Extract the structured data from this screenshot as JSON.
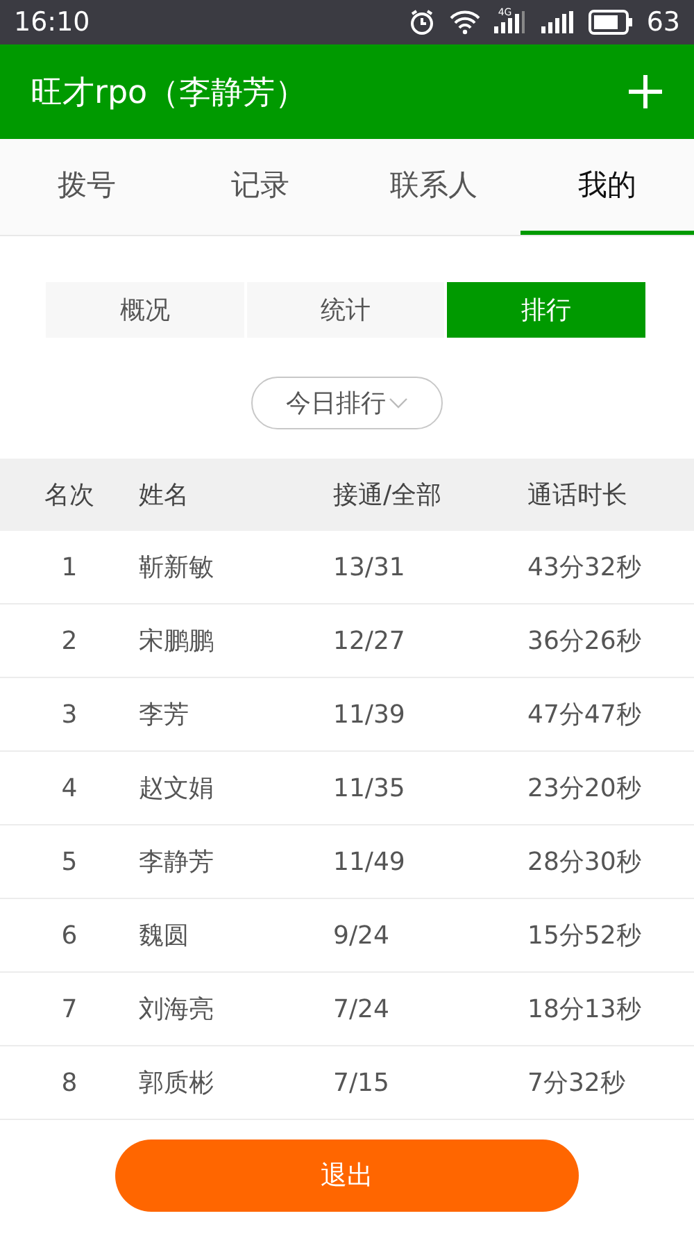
{
  "status_bar": {
    "time": "16:10",
    "network_label": "4G",
    "battery": "63"
  },
  "header": {
    "title": "旺才rpo（李静芳）"
  },
  "tabs": [
    {
      "label": "拨号",
      "selected": false
    },
    {
      "label": "记录",
      "selected": false
    },
    {
      "label": "联系人",
      "selected": false
    },
    {
      "label": "我的",
      "selected": true
    }
  ],
  "segments": [
    {
      "label": "概况",
      "selected": false
    },
    {
      "label": "统计",
      "selected": false
    },
    {
      "label": "排行",
      "selected": true
    }
  ],
  "period_dropdown": {
    "value": "今日排行"
  },
  "table": {
    "columns": [
      "名次",
      "姓名",
      "接通/全部",
      "通话时长"
    ],
    "rows": [
      [
        "1",
        "靳新敏",
        "13/31",
        "43分32秒"
      ],
      [
        "2",
        "宋鹏鹏",
        "12/27",
        "36分26秒"
      ],
      [
        "3",
        "李芳",
        "11/39",
        "47分47秒"
      ],
      [
        "4",
        "赵文娟",
        "11/35",
        "23分20秒"
      ],
      [
        "5",
        "李静芳",
        "11/49",
        "28分30秒"
      ],
      [
        "6",
        "魏圆",
        "9/24",
        "15分52秒"
      ],
      [
        "7",
        "刘海亮",
        "7/24",
        "18分13秒"
      ],
      [
        "8",
        "郭质彬",
        "7/15",
        "7分32秒"
      ]
    ]
  },
  "logout_button": "退出"
}
